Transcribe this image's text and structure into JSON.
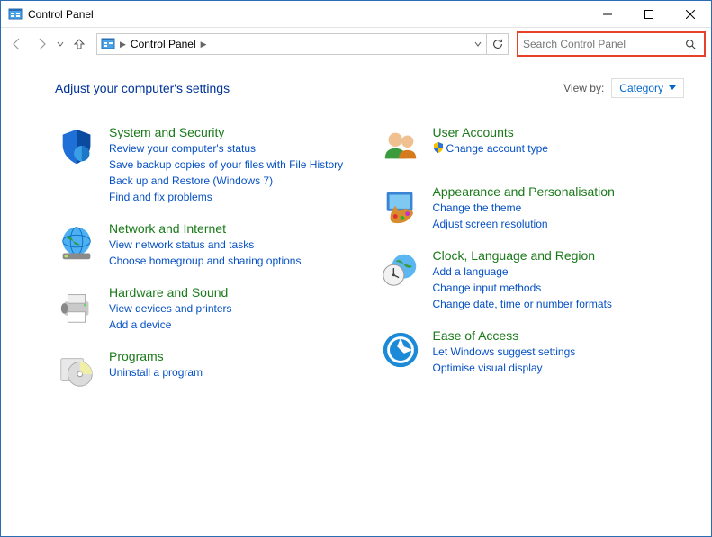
{
  "window": {
    "title": "Control Panel"
  },
  "breadcrumb": {
    "root": "Control Panel"
  },
  "search": {
    "placeholder": "Search Control Panel"
  },
  "header": {
    "heading": "Adjust your computer's settings",
    "viewby_label": "View by:",
    "viewby_value": "Category"
  },
  "categories": {
    "system_security": {
      "title": "System and Security",
      "links": [
        "Review your computer's status",
        "Save backup copies of your files with File History",
        "Back up and Restore (Windows 7)",
        "Find and fix problems"
      ]
    },
    "network": {
      "title": "Network and Internet",
      "links": [
        "View network status and tasks",
        "Choose homegroup and sharing options"
      ]
    },
    "hardware": {
      "title": "Hardware and Sound",
      "links": [
        "View devices and printers",
        "Add a device"
      ]
    },
    "programs": {
      "title": "Programs",
      "links": [
        "Uninstall a program"
      ]
    },
    "users": {
      "title": "User Accounts",
      "links": [
        "Change account type"
      ],
      "shield": [
        true
      ]
    },
    "appearance": {
      "title": "Appearance and Personalisation",
      "links": [
        "Change the theme",
        "Adjust screen resolution"
      ]
    },
    "clock": {
      "title": "Clock, Language and Region",
      "links": [
        "Add a language",
        "Change input methods",
        "Change date, time or number formats"
      ]
    },
    "ease": {
      "title": "Ease of Access",
      "links": [
        "Let Windows suggest settings",
        "Optimise visual display"
      ]
    }
  }
}
